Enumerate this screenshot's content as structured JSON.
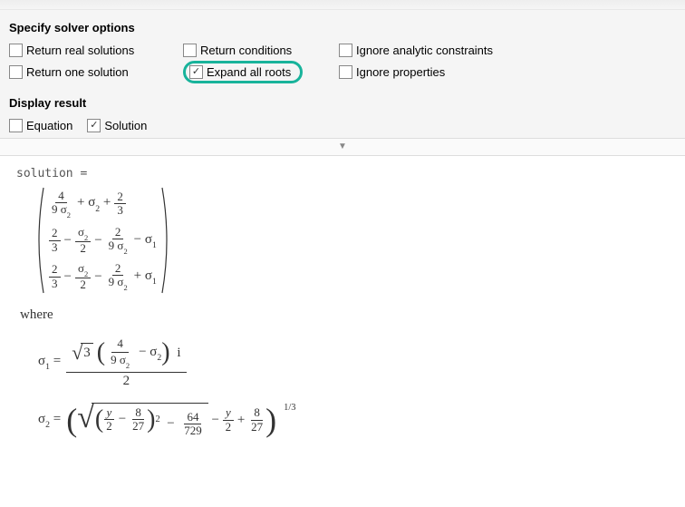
{
  "sections": {
    "solver_options_title": "Specify solver options",
    "display_title": "Display result"
  },
  "options": {
    "return_real": {
      "label": "Return real solutions",
      "checked": false
    },
    "return_one": {
      "label": "Return one solution",
      "checked": false
    },
    "return_conditions": {
      "label": "Return conditions",
      "checked": false
    },
    "expand_roots": {
      "label": "Expand all roots",
      "checked": true,
      "highlighted": true
    },
    "ignore_analytic": {
      "label": "Ignore analytic constraints",
      "checked": false
    },
    "ignore_properties": {
      "label": "Ignore properties",
      "checked": false
    }
  },
  "display": {
    "equation": {
      "label": "Equation",
      "checked": false
    },
    "solution": {
      "label": "Solution",
      "checked": true
    }
  },
  "collapse_glyph": "▼",
  "result": {
    "var_line": "solution =",
    "where_label": "where",
    "vector_rows": [
      "4/(9 σ2) + σ2 + 2/3",
      "2/3 − σ2/2 − 2/(9 σ2) − σ1",
      "2/3 − σ2/2 − 2/(9 σ2) + σ1"
    ],
    "sigma1_def": "σ1 = ( √3 · ( 4/(9 σ2) − σ2 ) · i ) / 2",
    "sigma2_def": "σ2 = ( √( (y/2 − 8/27)^2 − 64/729 ) − y/2 + 8/27 )^(1/3)"
  }
}
